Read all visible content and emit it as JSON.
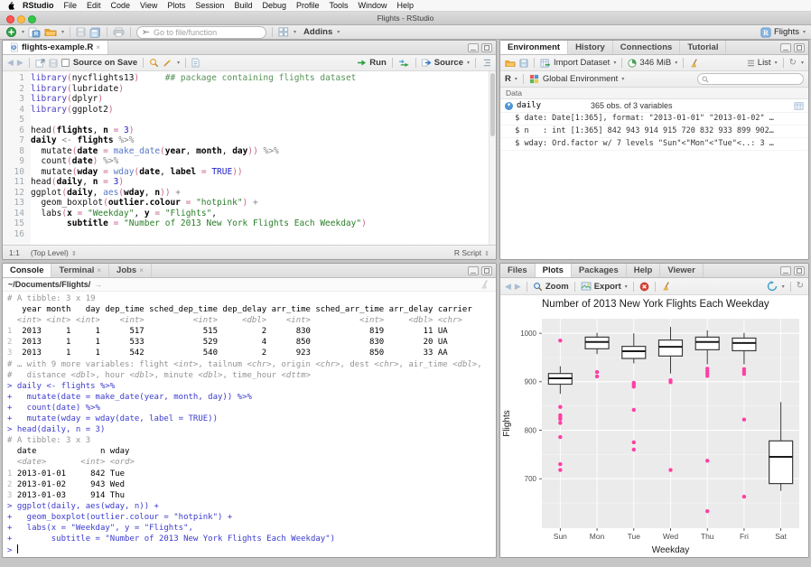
{
  "window": {
    "title": "Flights - RStudio",
    "menu": [
      "RStudio",
      "File",
      "Edit",
      "Code",
      "View",
      "Plots",
      "Session",
      "Build",
      "Debug",
      "Profile",
      "Tools",
      "Window",
      "Help"
    ]
  },
  "toolbar": {
    "goto_placeholder": "Go to file/function",
    "addins": "Addins",
    "project": "Flights"
  },
  "source_pane": {
    "tab": "flights-example.R",
    "toolbar": {
      "source_on_save": "Source on Save",
      "run": "Run",
      "source": "Source"
    },
    "status": {
      "cursor": "1:1",
      "scope": "(Top Level)",
      "type": "R Script"
    },
    "code": [
      [
        [
          "kw",
          "library"
        ],
        [
          "par",
          "("
        ],
        [
          "pl",
          "nycflights13"
        ],
        [
          "par",
          ")"
        ],
        [
          "pl",
          "     "
        ],
        [
          "com",
          "## package containing flights dataset"
        ]
      ],
      [
        [
          "kw",
          "library"
        ],
        [
          "par",
          "("
        ],
        [
          "pl",
          "lubridate"
        ],
        [
          "par",
          ")"
        ]
      ],
      [
        [
          "kw",
          "library"
        ],
        [
          "par",
          "("
        ],
        [
          "pl",
          "dplyr"
        ],
        [
          "par",
          ")"
        ]
      ],
      [
        [
          "kw",
          "library"
        ],
        [
          "par",
          "("
        ],
        [
          "pl",
          "ggplot2"
        ],
        [
          "par",
          ")"
        ]
      ],
      [],
      [
        [
          "pl",
          "head"
        ],
        [
          "par",
          "("
        ],
        [
          "var",
          "flights"
        ],
        [
          "pl",
          ", "
        ],
        [
          "var",
          "n"
        ],
        [
          "par",
          " = "
        ],
        [
          "num",
          "3"
        ],
        [
          "par",
          ")"
        ]
      ],
      [
        [
          "var",
          "daily"
        ],
        [
          "op",
          " <- "
        ],
        [
          "var",
          "flights"
        ],
        [
          "op",
          " %>%"
        ]
      ],
      [
        [
          "pl",
          "  mutate"
        ],
        [
          "par",
          "("
        ],
        [
          "var",
          "date"
        ],
        [
          "par",
          " = "
        ],
        [
          "fn2",
          "make_date"
        ],
        [
          "par",
          "("
        ],
        [
          "var",
          "year"
        ],
        [
          "pl",
          ", "
        ],
        [
          "var",
          "month"
        ],
        [
          "pl",
          ", "
        ],
        [
          "var",
          "day"
        ],
        [
          "par",
          "))"
        ],
        [
          "op",
          " %>%"
        ]
      ],
      [
        [
          "pl",
          "  count"
        ],
        [
          "par",
          "("
        ],
        [
          "var",
          "date"
        ],
        [
          "par",
          ")"
        ],
        [
          "op",
          " %>%"
        ]
      ],
      [
        [
          "pl",
          "  mutate"
        ],
        [
          "par",
          "("
        ],
        [
          "var",
          "wday"
        ],
        [
          "par",
          " = "
        ],
        [
          "fn2",
          "wday"
        ],
        [
          "par",
          "("
        ],
        [
          "var",
          "date"
        ],
        [
          "pl",
          ", "
        ],
        [
          "var",
          "label"
        ],
        [
          "par",
          " = "
        ],
        [
          "num",
          "TRUE"
        ],
        [
          "par",
          "))"
        ]
      ],
      [
        [
          "pl",
          "head"
        ],
        [
          "par",
          "("
        ],
        [
          "var",
          "daily"
        ],
        [
          "pl",
          ", "
        ],
        [
          "var",
          "n"
        ],
        [
          "par",
          " = "
        ],
        [
          "num",
          "3"
        ],
        [
          "par",
          ")"
        ]
      ],
      [
        [
          "pl",
          "ggplot"
        ],
        [
          "par",
          "("
        ],
        [
          "var",
          "daily"
        ],
        [
          "pl",
          ", "
        ],
        [
          "fn2",
          "aes"
        ],
        [
          "par",
          "("
        ],
        [
          "var",
          "wday"
        ],
        [
          "pl",
          ", "
        ],
        [
          "var",
          "n"
        ],
        [
          "par",
          "))"
        ],
        [
          "op",
          " +"
        ]
      ],
      [
        [
          "pl",
          "  geom_boxplot"
        ],
        [
          "par",
          "("
        ],
        [
          "var",
          "outlier.colour"
        ],
        [
          "par",
          " = "
        ],
        [
          "str",
          "\"hotpink\""
        ],
        [
          "par",
          ")"
        ],
        [
          "op",
          " +"
        ]
      ],
      [
        [
          "pl",
          "  labs"
        ],
        [
          "par",
          "("
        ],
        [
          "var",
          "x"
        ],
        [
          "par",
          " = "
        ],
        [
          "str",
          "\"Weekday\""
        ],
        [
          "pl",
          ", "
        ],
        [
          "var",
          "y"
        ],
        [
          "par",
          " = "
        ],
        [
          "str",
          "\"Flights\""
        ],
        [
          "pl",
          ","
        ]
      ],
      [
        [
          "pl",
          "       "
        ],
        [
          "var",
          "subtitle"
        ],
        [
          "par",
          " = "
        ],
        [
          "str",
          "\"Number of 2013 New York Flights Each Weekday\""
        ],
        [
          "par",
          ")"
        ]
      ],
      []
    ]
  },
  "console_pane": {
    "tabs": [
      "Console",
      "Terminal",
      "Jobs"
    ],
    "path": "~/Documents/Flights/",
    "lines": [
      [
        [
          "meta",
          "# A tibble: 3 x 19"
        ]
      ],
      [
        [
          "pln",
          "   year month   day dep_time sched_dep_time dep_delay arr_time sched_arr_time arr_delay carrier"
        ]
      ],
      [
        [
          "typ",
          "  <int> <int> <int>    <int>          <int>     <dbl>    <int>          <int>     <dbl> <chr>"
        ]
      ],
      [
        [
          "num",
          "1"
        ],
        [
          "pln",
          "  2013     1     1      517            515         2      830            819        11 UA"
        ]
      ],
      [
        [
          "num",
          "2"
        ],
        [
          "pln",
          "  2013     1     1      533            529         4      850            830        20 UA"
        ]
      ],
      [
        [
          "num",
          "3"
        ],
        [
          "pln",
          "  2013     1     1      542            540         2      923            850        33 AA"
        ]
      ],
      [
        [
          "meta",
          "# … with 9 more variables: flight "
        ],
        [
          "typ",
          "<int>"
        ],
        [
          "meta",
          ", tailnum "
        ],
        [
          "typ",
          "<chr>"
        ],
        [
          "meta",
          ", origin "
        ],
        [
          "typ",
          "<chr>"
        ],
        [
          "meta",
          ", dest "
        ],
        [
          "typ",
          "<chr>"
        ],
        [
          "meta",
          ", air_time "
        ],
        [
          "typ",
          "<dbl>"
        ],
        [
          "meta",
          ","
        ]
      ],
      [
        [
          "meta",
          "#   distance "
        ],
        [
          "typ",
          "<dbl>"
        ],
        [
          "meta",
          ", hour "
        ],
        [
          "typ",
          "<dbl>"
        ],
        [
          "meta",
          ", minute "
        ],
        [
          "typ",
          "<dbl>"
        ],
        [
          "meta",
          ", time_hour "
        ],
        [
          "typ",
          "<dttm>"
        ]
      ],
      [
        [
          "blu",
          "> daily <- flights %>%"
        ]
      ],
      [
        [
          "blu",
          "+   mutate(date = make_date(year, month, day)) %>%"
        ]
      ],
      [
        [
          "blu",
          "+   count(date) %>%"
        ]
      ],
      [
        [
          "blu",
          "+   mutate(wday = wday(date, label = TRUE))"
        ]
      ],
      [
        [
          "blu",
          "> head(daily, n = 3)"
        ]
      ],
      [
        [
          "meta",
          "# A tibble: 3 x 3"
        ]
      ],
      [
        [
          "pln",
          "  date             n wday"
        ]
      ],
      [
        [
          "typ",
          "  <date>       <int> <ord>"
        ]
      ],
      [
        [
          "num",
          "1"
        ],
        [
          "pln",
          " 2013-01-01     842 Tue"
        ]
      ],
      [
        [
          "num",
          "2"
        ],
        [
          "pln",
          " 2013-01-02     943 Wed"
        ]
      ],
      [
        [
          "num",
          "3"
        ],
        [
          "pln",
          " 2013-01-03     914 Thu"
        ]
      ],
      [
        [
          "blu",
          "> ggplot(daily, aes(wday, n)) +"
        ]
      ],
      [
        [
          "blu",
          "+   geom_boxplot(outlier.colour = \"hotpink\") +"
        ]
      ],
      [
        [
          "blu",
          "+   labs(x = \"Weekday\", y = \"Flights\","
        ]
      ],
      [
        [
          "blu",
          "+        subtitle = \"Number of 2013 New York Flights Each Weekday\")"
        ]
      ],
      [
        [
          "blu",
          "> "
        ],
        [
          "cursor",
          ""
        ]
      ]
    ]
  },
  "environment_pane": {
    "tabs": [
      "Environment",
      "History",
      "Connections",
      "Tutorial"
    ],
    "toolbar": {
      "import": "Import Dataset",
      "memory": "346 MiB",
      "list": "List"
    },
    "toolbar2": {
      "r": "R",
      "env": "Global Environment"
    },
    "section": "Data",
    "object": {
      "name": "daily",
      "desc": "365 obs. of 3 variables"
    },
    "details": [
      "  $ date: Date[1:365], format: \"2013-01-01\" \"2013-01-02\" …",
      "  $ n   : int [1:365] 842 943 914 915 720 832 933 899 902…",
      "  $ wday: Ord.factor w/ 7 levels \"Sun\"<\"Mon\"<\"Tue\"<..: 3 …"
    ]
  },
  "plots_pane": {
    "tabs": [
      "Files",
      "Plots",
      "Packages",
      "Help",
      "Viewer"
    ],
    "toolbar": {
      "zoom": "Zoom",
      "export": "Export"
    }
  },
  "chart_data": {
    "type": "boxplot",
    "title": "Number of 2013 New York Flights Each Weekday",
    "xlabel": "Weekday",
    "ylabel": "Flights",
    "categories": [
      "Sun",
      "Mon",
      "Tue",
      "Wed",
      "Thu",
      "Fri",
      "Sat"
    ],
    "ylim": [
      598,
      1030
    ],
    "yticks": [
      700,
      800,
      900,
      1000
    ],
    "yticks_minor": [
      650,
      750,
      850,
      950
    ],
    "grid": true,
    "panel_color": "#EBEBEB",
    "outlier_color": "#FF3FA4",
    "boxes": [
      {
        "category": "Sun",
        "whisker_low": 875,
        "q1": 895,
        "median": 907,
        "q3": 917,
        "whisker_high": 932,
        "outliers": [
          985,
          848,
          831,
          827,
          823,
          815,
          786,
          730,
          718
        ]
      },
      {
        "category": "Mon",
        "whisker_low": 957,
        "q1": 968,
        "median": 982,
        "q3": 992,
        "whisker_high": 1001,
        "outliers": [
          920,
          911
        ]
      },
      {
        "category": "Tue",
        "whisker_low": 938,
        "q1": 948,
        "median": 963,
        "q3": 973,
        "whisker_high": 1000,
        "outliers": [
          898,
          894,
          890,
          842,
          775,
          760
        ]
      },
      {
        "category": "Wed",
        "whisker_low": 917,
        "q1": 953,
        "median": 972,
        "q3": 986,
        "whisker_high": 1013,
        "outliers": [
          903,
          899,
          718
        ]
      },
      {
        "category": "Thu",
        "whisker_low": 936,
        "q1": 966,
        "median": 982,
        "q3": 992,
        "whisker_high": 1006,
        "outliers": [
          927,
          922,
          917,
          912,
          737,
          633
        ]
      },
      {
        "category": "Fri",
        "whisker_low": 936,
        "q1": 964,
        "median": 980,
        "q3": 990,
        "whisker_high": 1001,
        "outliers": [
          926,
          921,
          916,
          822,
          663
        ]
      },
      {
        "category": "Sat",
        "whisker_low": 675,
        "q1": 690,
        "median": 745,
        "q3": 778,
        "whisker_high": 858,
        "outliers": []
      }
    ]
  }
}
